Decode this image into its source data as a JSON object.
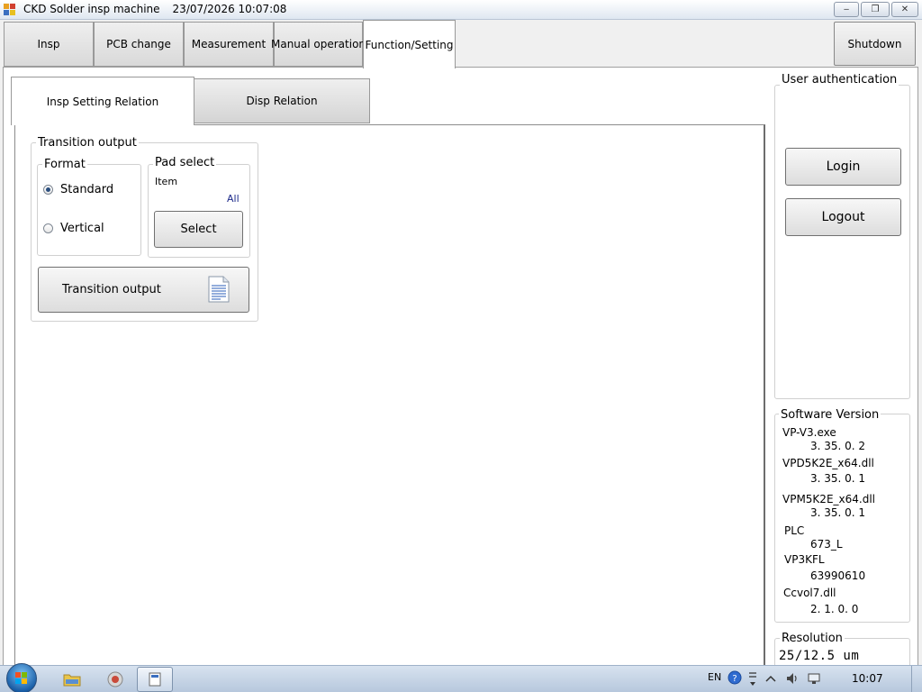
{
  "window": {
    "title": "CKD Solder insp machine",
    "datetime": "23/07/2026 10:07:08",
    "min_glyph": "‒",
    "max_glyph": "❐",
    "close_glyph": "✕"
  },
  "main_tabs": [
    {
      "label": "Insp"
    },
    {
      "label": "PCB change"
    },
    {
      "label": "Measurement"
    },
    {
      "label": "Manual operation"
    },
    {
      "label": "Function/Setting"
    }
  ],
  "main_tab_active": "Function/Setting",
  "shutdown_label": "Shutdown",
  "sub_tabs": [
    {
      "label": "Insp Setting Relation"
    },
    {
      "label": "Disp Relation"
    }
  ],
  "transition": {
    "group_title": "Transition output",
    "format": {
      "title": "Format",
      "options": [
        "Standard",
        "Vertical"
      ],
      "selected": "Standard"
    },
    "pad_select": {
      "title": "Pad select",
      "item_label": "Item",
      "item_value": "All",
      "select_button": "Select"
    },
    "output_button": "Transition output"
  },
  "user_auth": {
    "title": "User authentication",
    "login": "Login",
    "logout": "Logout"
  },
  "software_version": {
    "title": "Software Version",
    "entries": [
      {
        "name": "VP-V3.exe",
        "version": "3. 35. 0. 2"
      },
      {
        "name": "VPD5K2E_x64.dll",
        "version": "3. 35. 0. 1"
      },
      {
        "name": "VPM5K2E_x64.dll",
        "version": "3. 35. 0. 1"
      },
      {
        "name": "PLC",
        "version": "673_L"
      },
      {
        "name": "VP3KFL",
        "version": "63990610"
      },
      {
        "name": "Ccvol7.dll",
        "version": "2. 1. 0. 0"
      }
    ]
  },
  "resolution": {
    "title": "Resolution",
    "value": "25/12.5 um"
  },
  "taskbar": {
    "language": "EN",
    "clock": "10:07"
  },
  "colors": {
    "accent_radio": "#2a4e7e",
    "all_value": "#1c2a8a"
  }
}
